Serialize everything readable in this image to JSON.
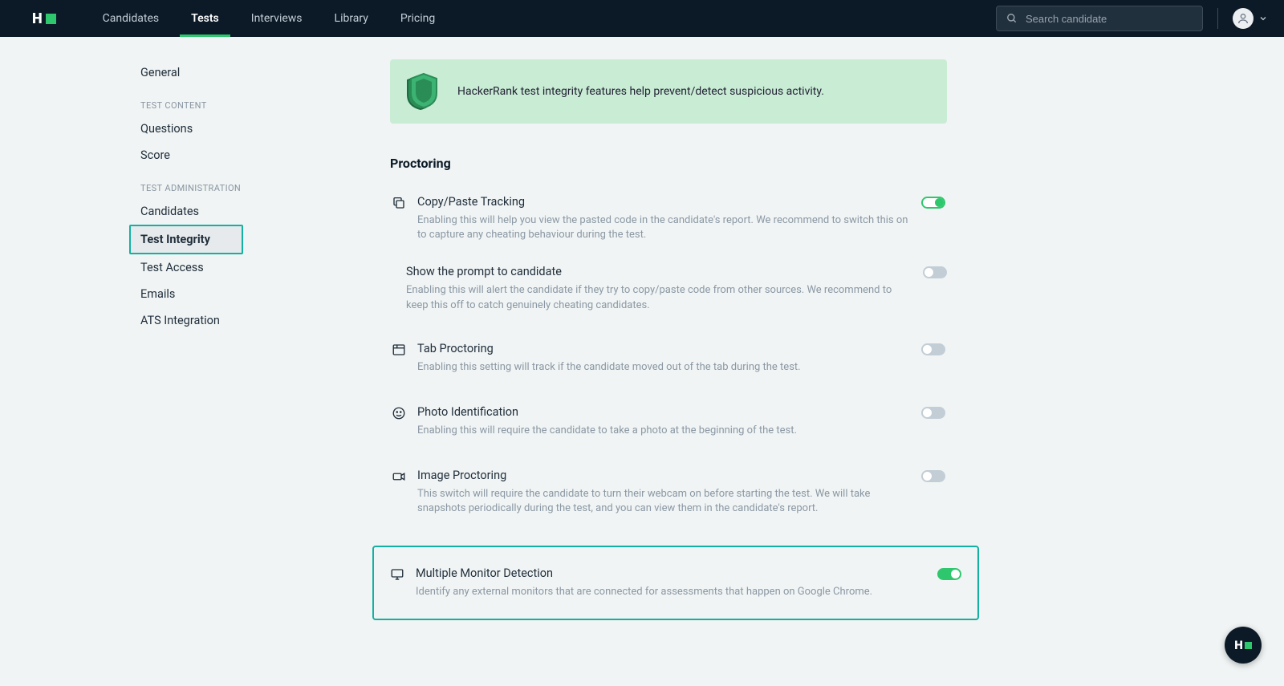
{
  "nav": {
    "links": [
      "Candidates",
      "Tests",
      "Interviews",
      "Library",
      "Pricing"
    ],
    "active_index": 1,
    "search_placeholder": "Search candidate"
  },
  "sidebar": {
    "general": "General",
    "section_content": "TEST CONTENT",
    "questions": "Questions",
    "score": "Score",
    "section_admin": "TEST ADMINISTRATION",
    "candidates": "Candidates",
    "test_integrity": "Test Integrity",
    "test_access": "Test Access",
    "emails": "Emails",
    "ats": "ATS Integration"
  },
  "banner": {
    "text": "HackerRank test integrity features help prevent/detect suspicious activity."
  },
  "section": {
    "title": "Proctoring"
  },
  "settings": {
    "copy_paste": {
      "title": "Copy/Paste Tracking",
      "desc": "Enabling this will help you view the pasted code in the candidate's report. We recommend to switch this on to capture any cheating behaviour during the test.",
      "on": true
    },
    "show_prompt": {
      "title": "Show the prompt to candidate",
      "desc": "Enabling this will alert the candidate if they try to copy/paste code from other sources. We recommend to keep this off to catch genuinely cheating candidates.",
      "on": false
    },
    "tab": {
      "title": "Tab Proctoring",
      "desc": "Enabling this setting will track if the candidate moved out of the tab during the test.",
      "on": false
    },
    "photo": {
      "title": "Photo Identification",
      "desc": "Enabling this will require the candidate to take a photo at the beginning of the test.",
      "on": false
    },
    "image": {
      "title": "Image Proctoring",
      "desc": "This switch will require the candidate to turn their webcam on before starting the test. We will take snapshots periodically during the test, and you can view them in the candidate's report.",
      "on": false
    },
    "monitor": {
      "title": "Multiple Monitor Detection",
      "desc": "Identify any external monitors that are connected for assessments that happen on Google Chrome.",
      "on": true
    }
  }
}
